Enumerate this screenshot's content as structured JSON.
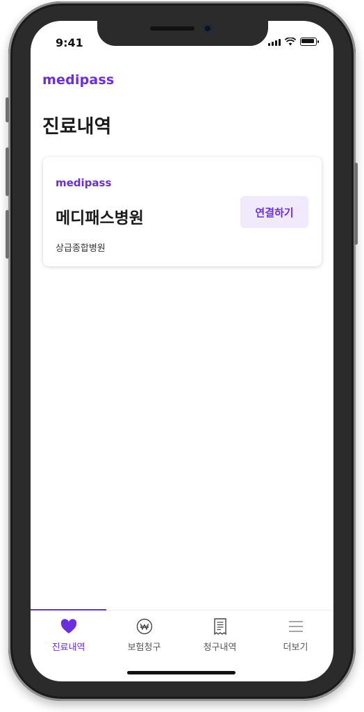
{
  "status_bar": {
    "time": "9:41"
  },
  "brand": {
    "logo_text": "medipass",
    "accent_color": "#6a2ee0"
  },
  "page": {
    "title": "진료내역"
  },
  "hospital_card": {
    "logo_text": "medipass",
    "name": "메디패스병원",
    "type": "상급종합병원",
    "connect_label": "연결하기"
  },
  "bottom_nav": {
    "items": [
      {
        "label": "진료내역",
        "icon": "heart-icon",
        "active": true
      },
      {
        "label": "보험청구",
        "icon": "won-coin-icon",
        "active": false
      },
      {
        "label": "청구내역",
        "icon": "receipt-icon",
        "active": false
      },
      {
        "label": "더보기",
        "icon": "menu-icon",
        "active": false
      }
    ]
  }
}
